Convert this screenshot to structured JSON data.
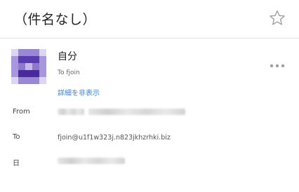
{
  "header": {
    "subject": "（件名なし）",
    "star_icon": "star-outline-icon"
  },
  "sender": {
    "name": "自分",
    "to_line": "To fjoin",
    "hide_details_label": "詳細を非表示",
    "avatar": "pixelated-avatar",
    "more_icon": "more-horizontal-icon"
  },
  "details": {
    "from_label": "From",
    "to_label": "To",
    "to_value": "fjoin@u1f1w323j.n823jkhzrhki.biz",
    "date_label": "日"
  },
  "colors": {
    "link": "#3b82d6",
    "avatar_dark": "#4a2a9a",
    "avatar_light": "#b6a6e0"
  }
}
